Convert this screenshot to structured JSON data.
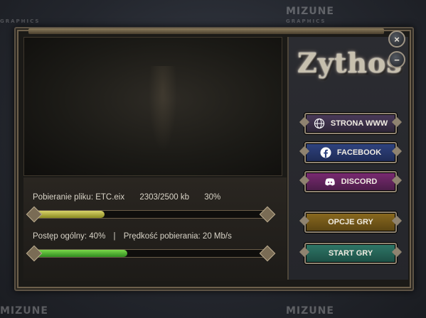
{
  "watermarks": {
    "brand": "MIZUNE",
    "sub": "GRAPHICS"
  },
  "logo": {
    "text": "Zythos"
  },
  "window_controls": {
    "close": "×",
    "minimize": "−"
  },
  "buttons": {
    "www": "STRONA WWW",
    "facebook": "FACEBOOK",
    "discord": "DISCORD",
    "options": "OPCJE GRY",
    "start": "START GRY"
  },
  "download": {
    "file_label": "Pobieranie pliku: ETC.eix",
    "file_size": "2303/2500 kb",
    "file_percent": "30%",
    "file_progress": 0.3,
    "overall_label": "Postęp ogólny: 40%",
    "separator": "|",
    "speed_label": "Prędkość pobierania: 20 Mb/s",
    "overall_progress": 0.4
  },
  "icons": {
    "www": "globe-icon",
    "facebook": "facebook-icon",
    "discord": "discord-icon"
  },
  "colors": {
    "file_bar": "#c9c44a",
    "overall_bar": "#5ec43a",
    "www_btn": "#4a3a5a",
    "facebook_btn": "#2f4380",
    "discord_btn": "#7a2a72",
    "options_btn": "#8a6a1f",
    "start_btn": "#2f7868"
  }
}
